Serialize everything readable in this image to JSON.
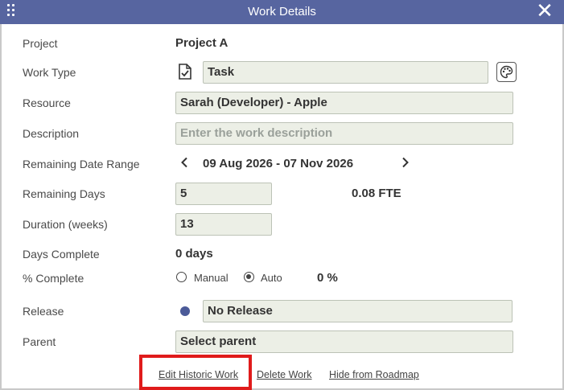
{
  "dialog": {
    "title": "Work Details",
    "close_glyph": "✕"
  },
  "labels": {
    "project": "Project",
    "work_type": "Work Type",
    "resource": "Resource",
    "description": "Description",
    "date_range": "Remaining Date Range",
    "remaining_days": "Remaining Days",
    "duration": "Duration (weeks)",
    "days_complete": "Days Complete",
    "pct_complete": "% Complete",
    "release": "Release",
    "parent": "Parent"
  },
  "values": {
    "project": "Project A",
    "work_type": "Task",
    "resource": "Sarah (Developer) - Apple",
    "description_placeholder": "Enter the work description",
    "date_range": "09 Aug 2026 - 07 Nov 2026",
    "remaining_days": "5",
    "fte": "0.08 FTE",
    "duration": "13",
    "days_complete": "0 days",
    "pct_mode_manual": "Manual",
    "pct_mode_auto": "Auto",
    "pct_mode_selected": "Auto",
    "pct_value": "0 %",
    "release": "No Release",
    "parent": "Select parent"
  },
  "links": {
    "edit_historic": "Edit Historic Work",
    "delete": "Delete Work",
    "hide": "Hide from Roadmap"
  },
  "colors": {
    "titlebar": "#5765a0",
    "field_bg": "#ecefe6",
    "highlight": "#e01b1b",
    "release_dot": "#4b5a98"
  },
  "icons": {
    "drag": "drag-grip-icon",
    "task": "task-document-icon",
    "palette": "palette-icon",
    "prev": "chevron-left-icon",
    "next": "chevron-right-icon",
    "close": "close-icon"
  }
}
